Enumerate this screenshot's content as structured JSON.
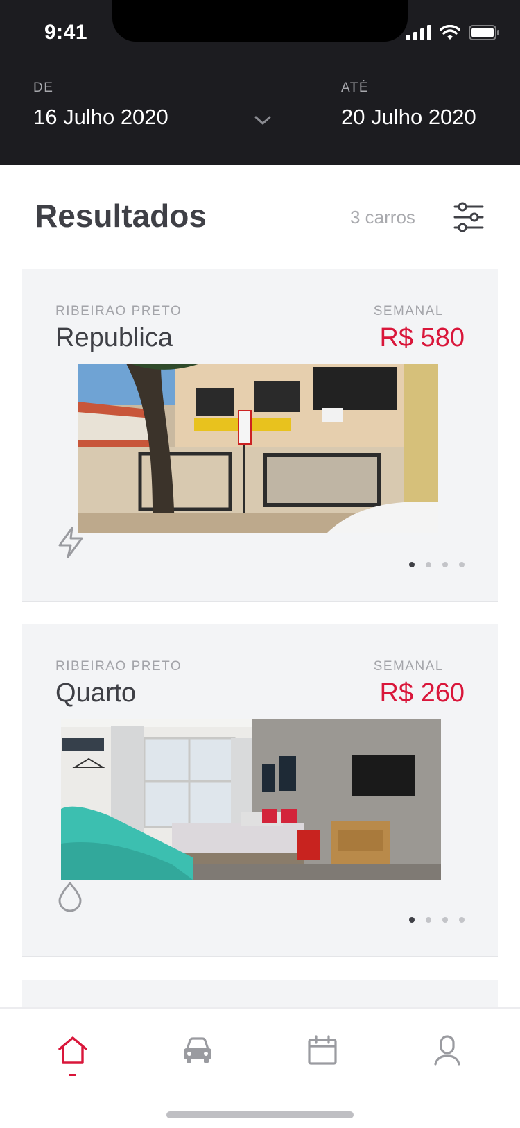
{
  "status_bar": {
    "time": "9:41"
  },
  "date_range": {
    "from_label": "DE",
    "from_value": "16 Julho 2020",
    "to_label": "ATÉ",
    "to_value": "20 Julho 2020"
  },
  "results": {
    "title": "Resultados",
    "count": "3 carros"
  },
  "listings": [
    {
      "city": "RIBEIRAO PRETO",
      "name": "Republica",
      "period": "SEMANAL",
      "price": "R$ 580",
      "feature_icon": "lightning-icon",
      "photo_index": 1,
      "photo_count": 4
    },
    {
      "city": "RIBEIRAO PRETO",
      "name": "Quarto",
      "period": "SEMANAL",
      "price": "R$ 260",
      "feature_icon": "water-drop-icon",
      "photo_index": 1,
      "photo_count": 4
    }
  ],
  "tabbar": {
    "items": [
      "home-icon",
      "car-icon",
      "calendar-icon",
      "profile-icon"
    ],
    "active": "home-icon"
  },
  "colors": {
    "header_bg": "#1c1c20",
    "accent": "#d9163a",
    "card_bg": "#f3f4f6",
    "text_primary": "#3f4046",
    "text_muted": "#a3a4a9"
  }
}
